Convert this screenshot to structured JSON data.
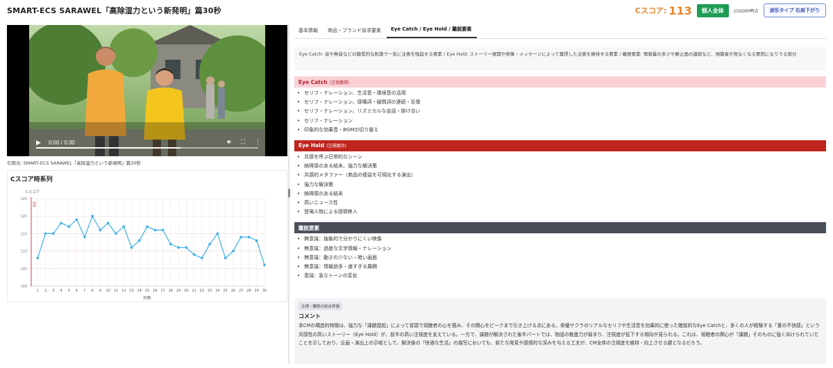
{
  "header": {
    "title": "SMART-ECS SARAWEL「高除湿力という新発明」篇30秒",
    "score_label": "Cスコア:",
    "score_value": "113",
    "audience_badge": "個人全体",
    "grp_note": "250GRP時点",
    "waveform_button": "波形タイプ 右肩下がり"
  },
  "video": {
    "time": "0:00 / 0:30",
    "caption": "引用元: SMART-ECS SARAWEL「高除湿力という新発明」篇30秒",
    "play_icon": "play-icon",
    "volume_icon": "volume-icon",
    "fullscreen_icon": "fullscreen-icon",
    "more_icon": "more-vertical-icon",
    "progress": 0.65
  },
  "chart": {
    "title": "Cスコア時系列"
  },
  "chart_data": {
    "type": "line",
    "ylabel": "Cスコア",
    "xlabel": "秒数",
    "ylim": [
      100,
      125
    ],
    "yticks": [
      100,
      105,
      110,
      115,
      120,
      125
    ],
    "grid": true,
    "x": [
      1,
      2,
      3,
      4,
      5,
      6,
      7,
      8,
      9,
      10,
      11,
      12,
      13,
      14,
      15,
      16,
      17,
      18,
      19,
      20,
      21,
      22,
      23,
      24,
      25,
      26,
      27,
      28,
      29,
      30
    ],
    "series": [
      {
        "values": [
          108,
          115,
          115,
          118,
          117,
          119,
          114,
          120,
          116,
          118,
          115,
          117,
          111,
          113,
          117,
          116,
          116,
          112,
          111,
          111,
          109,
          108,
          112,
          115,
          108,
          110,
          114,
          114,
          113,
          106
        ],
        "color": "#3bb0e8"
      }
    ],
    "marker": {
      "label": "冒頭",
      "x": 0,
      "color": "#d94040"
    }
  },
  "tabs": [
    {
      "label": "基本情報"
    },
    {
      "label": "商品・ブランド訴求要素"
    },
    {
      "label": "Eye Catch / Eye Hold / 離脱要素"
    }
  ],
  "description": "Eye Catch: 音や無音などの聴覚的な刺激で一気に注意を喚起する要素 / Eye Hold: ストーリー展開や映像・メッセージによって獲得した注意を維持する要素 / 離脱要素: 情報量の多さや静止画の連続など、視聴者が見なくなる要因になりうる部分",
  "eye_catch": {
    "title": "Eye Catch",
    "subtitle": "(注視獲得)",
    "items": [
      "セリフ・ナレーション、生活音・環境音の活用",
      "セリフ・ナレーション、感嘆詞・疑問詞の連続・反復",
      "セリフ・ナレーション、リズミカルな会話・掛け合い",
      "セリフ・ナレーション",
      "印象的な効果音・BGMの切り替え"
    ]
  },
  "eye_hold": {
    "title": "Eye Hold",
    "subtitle": "(注視継持)",
    "items": [
      "共感を呼ぶ日常的なシーン",
      "納得感のある結末、強力な解決策",
      "共感的メタファー（商品の便益を可視化する演出）",
      "強力な解決策",
      "納得感のある結末",
      "高いニュース性",
      "登場人物による感情移入"
    ]
  },
  "exit_elements": {
    "title": "離脱要素",
    "items": [
      "無意識：抽象的で分かりにくい映像",
      "無意識：過度な文字情報・ナレーション",
      "無意識：動きの少ない・暗い画面",
      "無意識：情報過多・速すぎる展開",
      "意識：急なトーンの変化"
    ]
  },
  "comment": {
    "tag": "注視・離脱の総合評価",
    "title": "コメント",
    "body": "本CMの構造的特徴は、強力な「課題提起」によって冒頭で視聴者の心を掴み、その関心をピークまで引き上げる点にある。俳優サクラのリアルなセリフや生活音を効果的に使った聴覚的なEye Catchと、多くの人が経験する「夏の不快感」という共感性の高いストーリー（Eye Hold）が、前半の高い注視度を支えている。一方で、課題が解決された後半パートでは、物語の推進力が弱まり、注視度が低下する傾向が見られる。これは、視聴者の関心が「課題」そのものに強く向けられていたことを示しており、企画・演出上の示唆として、解決後の「快適な生活」の描写においても、新たな発見や感情的な深みを与える工夫が、CM全体の注視度を維持・向上させる鍵となるだろう。"
  },
  "colors": {
    "accent_orange": "#e6862b",
    "green": "#1f9d55",
    "eye_catch_bg": "#f9d1d6",
    "eye_hold_bg": "#c0251f",
    "exit_bg": "#4a4f5a",
    "line": "#3bb0e8"
  }
}
